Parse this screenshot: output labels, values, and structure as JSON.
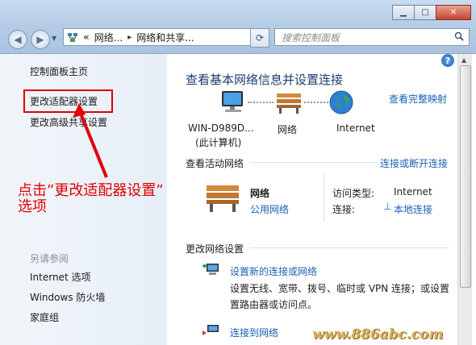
{
  "window": {
    "min_label": "▁",
    "max_label": "□",
    "close_label": "✕"
  },
  "address": {
    "chev": "«",
    "seg1": "网络...",
    "seg2": "网络和共享...",
    "arrow": "▸"
  },
  "search": {
    "placeholder": "搜索控制面板"
  },
  "sidebar": {
    "items": [
      {
        "label": "控制面板主页"
      },
      {
        "label": "更改适配器设置"
      },
      {
        "label": "更改高级共享设置"
      }
    ],
    "see_also_title": "另请参阅",
    "see_also": [
      {
        "label": "Internet 选项"
      },
      {
        "label": "Windows 防火墙"
      },
      {
        "label": "家庭组"
      }
    ]
  },
  "main": {
    "heading": "查看基本网络信息并设置连接",
    "full_map": "查看完整映射",
    "map": {
      "computer": "WIN-D989D...",
      "computer_sub": "(此计算机)",
      "network": "网络",
      "internet": "Internet"
    },
    "active_title": "查看活动网络",
    "connect_disconnect": "连接或断开连接",
    "net_name": "网络",
    "net_type": "公用网络",
    "access_type_label": "访问类型:",
    "access_type_value": "Internet",
    "connections_label": "连接:",
    "connections_value": "本地连接",
    "change_title": "更改网络设置",
    "setup_title": "设置新的连接或网络",
    "setup_desc1": "设置无线、宽带、拨号、临时或 VPN 连接；或设置",
    "setup_desc2": "置路由器或访问点。",
    "connect_to": "连接到网络"
  },
  "annotation": {
    "line1": "点击”更改适配器设置”",
    "line2": "选项"
  },
  "watermark": "www.886abc.com",
  "colors": {
    "annotation": "#e00000",
    "link": "#1a5fb4",
    "sidebar_bg": "#eaf0f8"
  }
}
